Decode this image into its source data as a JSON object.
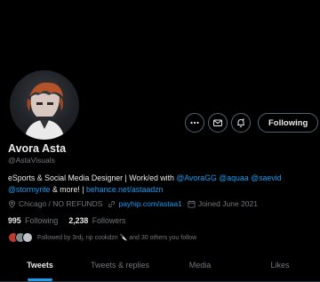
{
  "profile": {
    "name": "Avora Asta",
    "handle": "@AstaVisuals",
    "bio": {
      "text_1": "eSports & Social Media Designer | Work/ed with ",
      "link_1": "@AvoraGG",
      "space_1": " ",
      "link_2": "@aquaa",
      "space_2": " ",
      "link_3": "@saevid",
      "space_3": " ",
      "link_4": "@stormyrite",
      "text_2": " & more! | ",
      "link_5": "behance.net/astaadzn"
    },
    "location": "Chicago / NO REFUNDS",
    "website": "payhip.com/astaa1",
    "joined": "Joined June 2021",
    "following_count": "995",
    "following_label": "Following",
    "followers_count": "2,238",
    "followers_label": "Followers",
    "followed_by": "Followed by 3rdj, rip cookdzn 🔪 and 30 others you follow"
  },
  "actions": {
    "follow_label": "Following"
  },
  "tabs": [
    {
      "label": "Tweets"
    },
    {
      "label": "Tweets & replies"
    },
    {
      "label": "Media"
    },
    {
      "label": "Likes"
    }
  ],
  "colors": {
    "accent": "#1d9bf0",
    "background": "#000000",
    "text": "#e7e9ea",
    "muted": "#71767b"
  }
}
